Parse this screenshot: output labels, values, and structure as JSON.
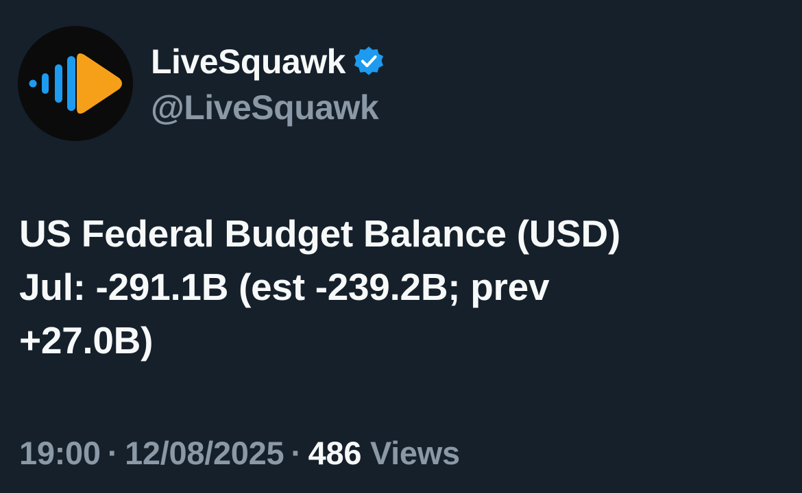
{
  "author": {
    "display_name": "LiveSquawk",
    "handle": "@LiveSquawk",
    "verified": true,
    "avatar_icon": "livesquawk-logo-icon",
    "verified_icon": "verified-badge-icon"
  },
  "tweet": {
    "lines": [
      "US Federal Budget Balance (USD)",
      "Jul: -291.1B (est -239.2B; prev",
      "+27.0B)"
    ]
  },
  "meta": {
    "time": "19:00",
    "date": "12/08/2025",
    "separator": "·",
    "views_count": "486",
    "views_label": "Views"
  },
  "colors": {
    "background": "#15202b",
    "primary_text": "#f7f9f9",
    "secondary_text": "#8b98a5",
    "verified_blue": "#1d9bf0",
    "logo_orange": "#f6a01a",
    "logo_blue": "#1d9bf0"
  }
}
